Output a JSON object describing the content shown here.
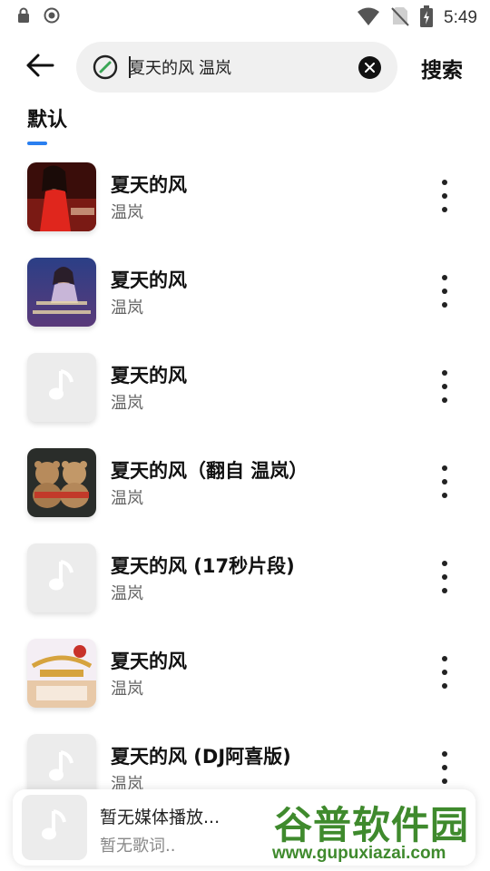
{
  "status_bar": {
    "time": "5:49"
  },
  "search": {
    "query": "夏天的风 温岚",
    "action_label": "搜索"
  },
  "tabs": [
    {
      "label": "默认",
      "active": true
    }
  ],
  "results": [
    {
      "title": "夏天的风",
      "artist": "温岚",
      "cover": "red-dress-photo"
    },
    {
      "title": "夏天的风",
      "artist": "温岚",
      "cover": "concert-poster"
    },
    {
      "title": "夏天的风",
      "artist": "温岚",
      "cover": "placeholder-note"
    },
    {
      "title": "夏天的风（翻自 温岚）",
      "artist": "温岚",
      "cover": "teddy-bears"
    },
    {
      "title": "夏天的风 (17秒片段)",
      "artist": "温岚",
      "cover": "placeholder-note"
    },
    {
      "title": "夏天的风",
      "artist": "温岚",
      "cover": "stage-show"
    },
    {
      "title": "夏天的风 (DJ阿喜版)",
      "artist": "温岚",
      "cover": "placeholder-note"
    }
  ],
  "player": {
    "title": "暂无媒体播放...",
    "subtitle": "暂无歌词.."
  },
  "watermark": {
    "top": "谷普软件园",
    "bottom": "www.gupuxiazai.com"
  },
  "colors": {
    "accent": "#2a7ff0",
    "watermark": "#3f8a2d"
  }
}
